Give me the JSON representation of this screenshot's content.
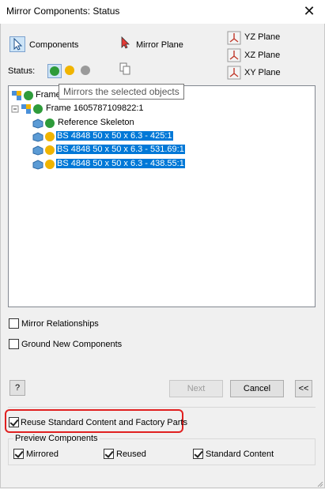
{
  "window": {
    "title": "Mirror Components: Status",
    "close_glyph": "✕"
  },
  "top": {
    "components_label": "Components",
    "mirror_plane_label": "Mirror Plane",
    "planes": [
      "YZ Plane",
      "XZ Plane",
      "XY Plane"
    ],
    "status_label": "Status:"
  },
  "tooltip": "Mirrors the selected objects",
  "tree": {
    "root_label": "Frame",
    "items": [
      {
        "label": "Frame 1605787109822:1",
        "icon": "assembly-icon",
        "status": "mirror",
        "selected": false
      },
      {
        "label": "Reference Skeleton",
        "icon": "part-icon",
        "status": "mirror",
        "selected": false
      },
      {
        "label": "BS 4848 50 x 50 x 6.3 - 425:1",
        "icon": "part-icon",
        "status": "reuse",
        "selected": true
      },
      {
        "label": "BS 4848 50 x 50 x 6.3 - 531.69:1",
        "icon": "part-icon",
        "status": "reuse",
        "selected": true
      },
      {
        "label": "BS 4848 50 x 50 x 6.3 - 438.55:1",
        "icon": "part-icon",
        "status": "reuse",
        "selected": true
      }
    ]
  },
  "options": {
    "mirror_relationships": "Mirror Relationships",
    "ground_new_components": "Ground New Components"
  },
  "buttons": {
    "help": "?",
    "next": "Next",
    "cancel": "Cancel",
    "collapse": "<<"
  },
  "reuse_standard": {
    "label": "Reuse Standard Content and Factory Parts",
    "checked": true
  },
  "preview": {
    "legend": "Preview Components",
    "mirrored": "Mirrored",
    "reused": "Reused",
    "standard_content": "Standard Content"
  },
  "colors": {
    "mirror_green": "#2e9b3a",
    "reuse_yellow": "#f0b400",
    "exclude_gray": "#9a9a9a",
    "selection": "#0078d7",
    "highlight_red": "#e02020"
  }
}
